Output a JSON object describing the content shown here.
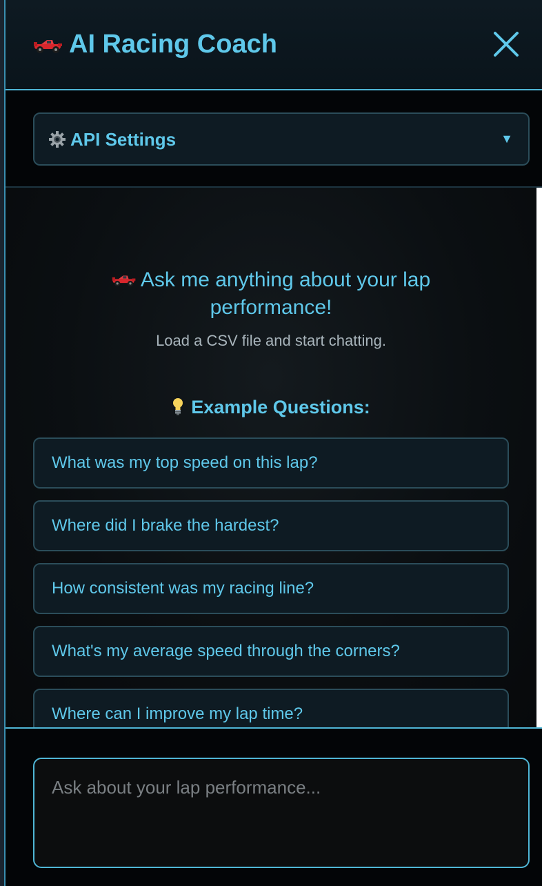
{
  "header": {
    "title": "AI Racing Coach",
    "close_label": "Close"
  },
  "settings": {
    "label": "API Settings",
    "caret": "▼"
  },
  "welcome": {
    "title": "Ask me anything about your lap performance!",
    "subtitle": "Load a CSV file and start chatting."
  },
  "examples": {
    "heading": "Example Questions:",
    "items": [
      "What was my top speed on this lap?",
      "Where did I brake the hardest?",
      "How consistent was my racing line?",
      "What's my average speed through the corners?",
      "Where can I improve my lap time?"
    ]
  },
  "input": {
    "placeholder": "Ask about your lap performance..."
  },
  "icons": {
    "title_icon": "race-car-icon",
    "settings_icon": "gear-icon",
    "close_icon": "close-icon",
    "examples_icon": "lightbulb-icon"
  },
  "colors": {
    "accent": "#5fc8ea",
    "border": "#4fb6d6",
    "card_bg": "#0e1b23",
    "card_border": "#2b4d5a",
    "subtext": "#a8b4bb",
    "background": "#05080b"
  }
}
